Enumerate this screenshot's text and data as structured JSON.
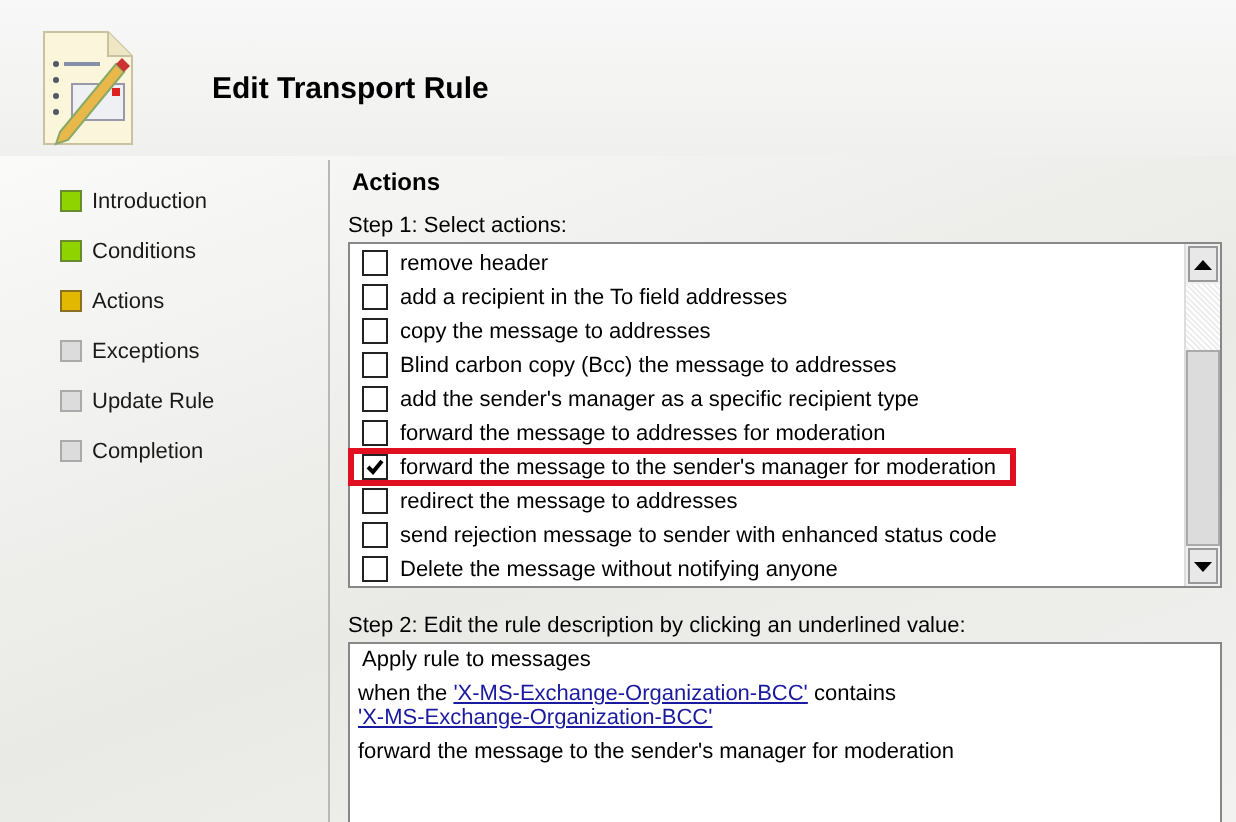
{
  "header": {
    "title": "Edit Transport Rule"
  },
  "steps": [
    {
      "label": "Introduction",
      "kind": "complete"
    },
    {
      "label": "Conditions",
      "kind": "complete"
    },
    {
      "label": "Actions",
      "kind": "current"
    },
    {
      "label": "Exceptions",
      "kind": "pending"
    },
    {
      "label": "Update Rule",
      "kind": "pending"
    },
    {
      "label": "Completion",
      "kind": "pending"
    }
  ],
  "section_title": "Actions",
  "step1_label": "Step 1: Select actions:",
  "actions": [
    {
      "label": "remove header",
      "checked": false,
      "highlighted": false
    },
    {
      "label": "add a recipient in the To field addresses",
      "checked": false,
      "highlighted": false
    },
    {
      "label": "copy the message to addresses",
      "checked": false,
      "highlighted": false
    },
    {
      "label": "Blind carbon copy (Bcc) the message to addresses",
      "checked": false,
      "highlighted": false
    },
    {
      "label": "add the sender's manager as a specific recipient type",
      "checked": false,
      "highlighted": false
    },
    {
      "label": "forward the message to addresses for moderation",
      "checked": false,
      "highlighted": false
    },
    {
      "label": "forward the message to the sender's manager for moderation",
      "checked": true,
      "highlighted": true
    },
    {
      "label": "redirect the message to addresses",
      "checked": false,
      "highlighted": false
    },
    {
      "label": "send rejection message to sender with enhanced status code",
      "checked": false,
      "highlighted": false
    },
    {
      "label": "Delete the message without notifying anyone",
      "checked": false,
      "highlighted": false
    }
  ],
  "step2_label": "Step 2: Edit the rule description by clicking an underlined value:",
  "description": [
    [
      {
        "text": "Apply rule to messages",
        "link": false
      }
    ],
    [
      {
        "text": "when the ",
        "link": false
      },
      {
        "text": "'X-MS-Exchange-Organization-BCC'",
        "link": true
      },
      {
        "text": " contains ",
        "link": false
      },
      {
        "text": "'X-MS-Exchange-Organization-BCC'",
        "link": true
      }
    ],
    [
      {
        "text": "forward the message to the sender's manager for moderation",
        "link": false
      }
    ]
  ]
}
